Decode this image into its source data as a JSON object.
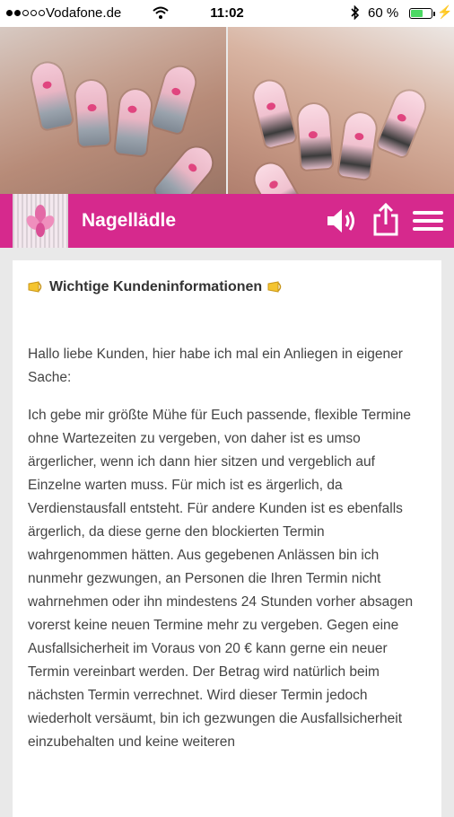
{
  "status_bar": {
    "carrier": "Vodafone.de",
    "time": "11:02",
    "battery_text": "60 %",
    "battery_level": 0.6,
    "icons": [
      "signal-dots-icon",
      "wifi-icon",
      "bluetooth-icon",
      "battery-icon",
      "charging-icon"
    ]
  },
  "app_bar": {
    "title": "Nagellädle",
    "background_color": "#d6298d",
    "icons": [
      "speaker-icon",
      "share-icon",
      "menu-icon"
    ]
  },
  "article": {
    "title": "Wichtige Kundeninformationen",
    "paragraphs": [
      "Hallo liebe Kunden, hier habe ich mal ein Anliegen in eigener Sache:",
      "Ich gebe mir größte Mühe für Euch passende, flexible Termine ohne Wartezeiten zu vergeben, von daher ist es umso ärgerlicher, wenn ich dann hier sitzen und vergeblich auf Einzelne warten muss. Für mich ist es ärgerlich, da Verdienstausfall entsteht. Für andere Kunden ist es ebenfalls ärgerlich, da diese gerne den blockierten Termin wahrgenommen hätten. Aus gegebenen Anlässen bin ich nunmehr gezwungen, an Personen die Ihren Termin nicht wahrnehmen oder ihn mindestens 24 Stunden vorher absagen vorerst keine neuen Termine mehr zu vergeben. Gegen eine Ausfallsicherheit im Voraus von 20 € kann gerne ein neuer Termin vereinbart werden. Der Betrag wird natürlich beim nächsten Termin verrechnet. Wird dieser Termin jedoch wiederholt versäumt, bin ich gezwungen die Ausfallsicherheit einzubehalten und keine weiteren"
    ]
  }
}
